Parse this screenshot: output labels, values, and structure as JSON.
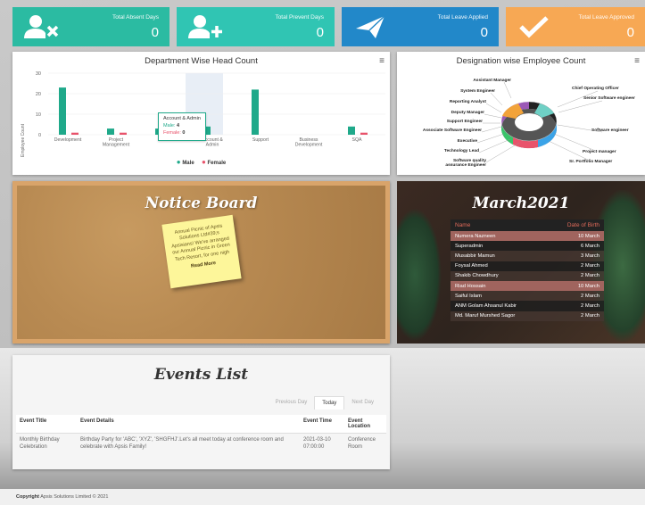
{
  "stats": [
    {
      "label": "Total Absent Days",
      "value": "0",
      "icon": "user-x-icon"
    },
    {
      "label": "Total Prevent Days",
      "value": "0",
      "icon": "user-plus-icon"
    },
    {
      "label": "Total Leave Applied",
      "value": "0",
      "icon": "paper-plane-icon"
    },
    {
      "label": "Total Leave Approved",
      "value": "0",
      "icon": "checkmark-icon"
    }
  ],
  "dept_chart": {
    "title": "Department Wise Head Count",
    "ylabel": "Employee Count",
    "yticks": [
      "30",
      "20",
      "10",
      "0"
    ],
    "tooltip": {
      "title": "Account & Admin",
      "male_label": "Male:",
      "male_value": "4",
      "female_label": "Female:",
      "female_value": "0"
    },
    "legend_male": "Male",
    "legend_female": "Female"
  },
  "chart_data": {
    "type": "bar",
    "title": "Department Wise Head Count",
    "ylabel": "Employee Count",
    "ylim": [
      0,
      30
    ],
    "categories": [
      "Development",
      "Project Management",
      "HR",
      "Account & Admin",
      "Support",
      "Business Development",
      "SQA"
    ],
    "series": [
      {
        "name": "Male",
        "values": [
          23,
          3,
          3,
          4,
          22,
          0,
          4
        ]
      },
      {
        "name": "Female",
        "values": [
          1,
          1,
          0,
          0,
          0,
          0,
          1
        ]
      }
    ],
    "colors": {
      "Male": "#1fa98a",
      "Female": "#e8536b"
    }
  },
  "desig_chart": {
    "title": "Designation wise Employee Count",
    "left_labels": [
      "Assistant Manager",
      "System Engineer",
      "Reporting Analyst",
      "Deputy Manager",
      "Support Engineer",
      "Associate Software Engineer",
      "Executive",
      "Technology Lead",
      "Software quality assurance Engineer"
    ],
    "right_labels": [
      "Chief Operating Officer",
      "Senior Software engineer",
      "Software engineer",
      "Project manager",
      "Sr. Portfolio Manager"
    ]
  },
  "notice": {
    "title": "Notice Board",
    "text": "Annual Picnic of Apsis Solutions Ltd#39;s Apsisians! We've arranged our Annual Picnic in Green Tech Resort, for one nigh",
    "read_more": "Read More"
  },
  "birthday": {
    "title": "March2021",
    "col_name": "Name",
    "col_dob": "Date of Birth",
    "rows": [
      {
        "name": "Numera Nazneen",
        "dob": "10 March"
      },
      {
        "name": "Superadmin",
        "dob": "6 March"
      },
      {
        "name": "Musabbir Mamun",
        "dob": "3 March"
      },
      {
        "name": "Foysal Ahmed",
        "dob": "2 March"
      },
      {
        "name": "Shakib Chowdhury",
        "dob": "2 March"
      },
      {
        "name": "Riad Hossain",
        "dob": "10 March"
      },
      {
        "name": "Saiful Islam",
        "dob": "2 March"
      },
      {
        "name": "ANM Golam Ahsanul Kabir",
        "dob": "2 March"
      },
      {
        "name": "Md. Maruf Murshed Sagor",
        "dob": "2 March"
      }
    ]
  },
  "events": {
    "title": "Events List",
    "tabs": [
      "Previous Day",
      "Today",
      "Next Day"
    ],
    "headers": [
      "Event Title",
      "Event Details",
      "Event Time",
      "Event Location"
    ],
    "rows": [
      {
        "title": "Monthly Birthday Celebration",
        "details": "Birthday Party for 'ABC', 'XYZ', 'SHGFHJ'.Let's all meet today at conference room and celebrate with Apsis Family!",
        "time": "2021-03-10 07:00:00",
        "location": "Conference Room"
      }
    ]
  },
  "footer": {
    "bold": "Copyright",
    "text": "Apsis Solutions Limited © 2021"
  }
}
